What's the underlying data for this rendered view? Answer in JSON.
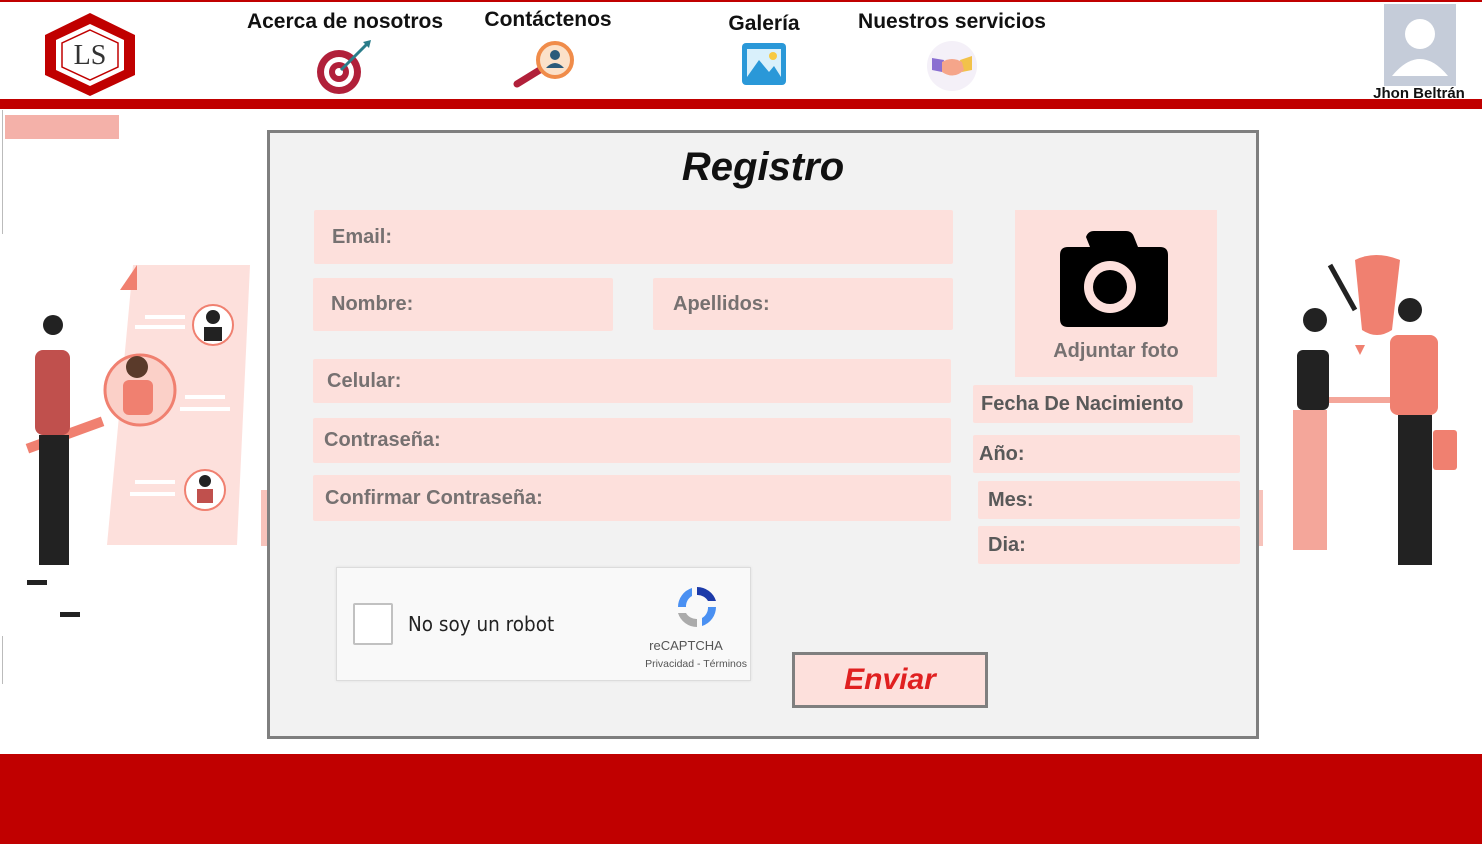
{
  "header": {
    "logo_text": "LS",
    "nav": [
      {
        "label": "Acerca de nosotros",
        "icon": "target-icon"
      },
      {
        "label": "Contáctenos",
        "icon": "magnifier-contact-icon"
      },
      {
        "label": "Galería",
        "icon": "image-gallery-icon"
      },
      {
        "label": "Nuestros servicios",
        "icon": "handshake-icon"
      }
    ],
    "user": {
      "name": "Jhon Beltrán",
      "icon": "avatar-icon"
    }
  },
  "form": {
    "title": "Registro",
    "email_label": "Email:",
    "nombre_label": "Nombre:",
    "apellidos_label": "Apellidos:",
    "celular_label": "Celular:",
    "contrasena_label": "Contraseña:",
    "confirmar_label": "Confirmar Contraseña:",
    "photo_label": "Adjuntar foto",
    "fecha_label": "Fecha De Nacimiento",
    "anio_label": "Año:",
    "mes_label": "Mes:",
    "dia_label": "Dia:",
    "captcha": {
      "label": "No soy un robot",
      "brand": "reCAPTCHA",
      "links": "Privacidad - Términos"
    },
    "submit_label": "Enviar"
  },
  "colors": {
    "brand_red": "#c00000",
    "field_pink": "#fde0dc",
    "panel_bg": "#f2f2f2",
    "submit_text": "#e02020"
  }
}
